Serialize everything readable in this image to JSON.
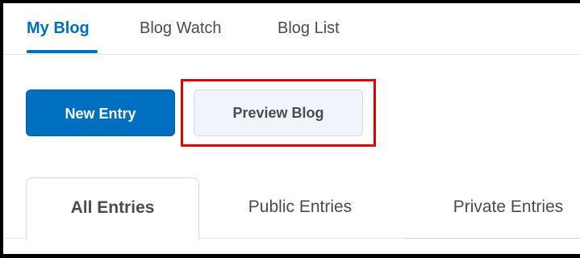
{
  "nav": {
    "tabs": [
      {
        "label": "My Blog",
        "active": true
      },
      {
        "label": "Blog Watch",
        "active": false
      },
      {
        "label": "Blog List",
        "active": false
      }
    ]
  },
  "actions": {
    "new_entry_label": "New Entry",
    "preview_blog_label": "Preview Blog"
  },
  "entry_tabs": [
    {
      "label": "All Entries",
      "active": true
    },
    {
      "label": "Public Entries",
      "active": false
    },
    {
      "label": "Private Entries",
      "active": false
    }
  ],
  "colors": {
    "accent": "#006fbf",
    "highlight": "#e50000",
    "text": "#494c4e"
  }
}
